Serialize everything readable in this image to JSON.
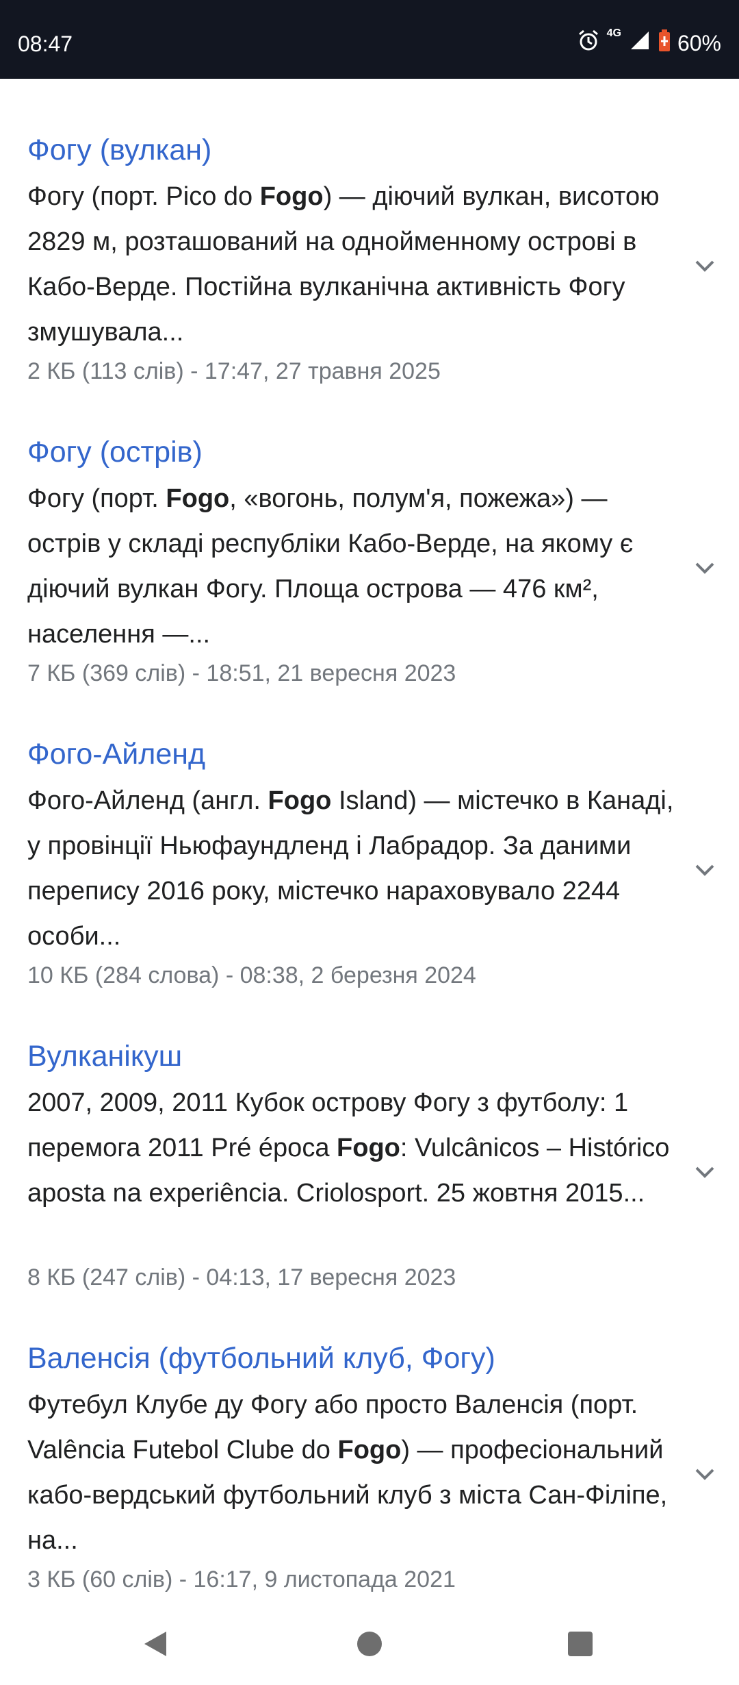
{
  "status_bar": {
    "time": "08:47",
    "network": "4G",
    "battery": "60%",
    "icons": [
      "alarm-icon",
      "signal-icon",
      "battery-saver-icon"
    ]
  },
  "results": [
    {
      "title": "Фогу (вулкан)",
      "snippet": [
        {
          "text": "Фогу (порт. Pico do ",
          "bold": false
        },
        {
          "text": "Fogo",
          "bold": true
        },
        {
          "text": ") — діючий вулкан, висотою 2829 м, розташований на однойменному острові в Кабо-Верде. Постійна вулканічна активність Фогу змушувала...",
          "bold": false
        }
      ],
      "meta": "2 КБ (113 слів) - 17:47, 27 травня 2025"
    },
    {
      "title": "Фогу (острів)",
      "snippet": [
        {
          "text": "Фогу (порт. ",
          "bold": false
        },
        {
          "text": "Fogo",
          "bold": true
        },
        {
          "text": ", «вогонь, полум'я, пожежа») — острів у складі республіки Кабо-Верде, на якому є діючий вулкан Фогу. Площа острова — 476 км², населення —...",
          "bold": false
        }
      ],
      "meta": "7 КБ (369 слів) - 18:51, 21 вересня 2023"
    },
    {
      "title": "Фого-Айленд",
      "snippet": [
        {
          "text": "Фого-Айленд (англ. ",
          "bold": false
        },
        {
          "text": "Fogo",
          "bold": true
        },
        {
          "text": " Island) — містечко в Канаді, у провінції Ньюфаундленд і Лабрадор. За даними перепису 2016 року, містечко нараховувало 2244 особи...",
          "bold": false
        }
      ],
      "meta": "10 КБ (284 слова) - 08:38, 2 березня 2024"
    },
    {
      "title": "Вулканікуш",
      "snippet": [
        {
          "text": "2007, 2009, 2011 Кубок острову Фогу з футболу: 1 перемога 2011 Pré época ",
          "bold": false
        },
        {
          "text": "Fogo",
          "bold": true
        },
        {
          "text": ": Vulcânicos – Histórico aposta na experiência. Criolosport. 25 жовтня 2015...",
          "bold": false
        }
      ],
      "meta": "8 КБ (247 слів) - 04:13, 17 вересня 2023"
    },
    {
      "title": "Валенсія (футбольний клуб, Фогу)",
      "snippet": [
        {
          "text": "Футебул Клубе ду Фогу або просто Валенсія (порт. Valência Futebol Clube do ",
          "bold": false
        },
        {
          "text": "Fogo",
          "bold": true
        },
        {
          "text": ") — професіональний кабо-вердський футбольний клуб з міста Сан-Філіпе, на...",
          "bold": false
        }
      ],
      "meta": "3 КБ (60 слів) - 16:17, 9 листопада 2021"
    }
  ],
  "nav_bar": {
    "buttons": [
      "back-icon",
      "home-icon",
      "recents-icon"
    ]
  },
  "colors": {
    "status_bar_bg": "#121621",
    "link": "#3366cc",
    "text": "#202122",
    "meta": "#72777d",
    "chevron": "#72777d",
    "nav_icon": "#6e6e6e",
    "battery_accent": "#e8542b"
  }
}
